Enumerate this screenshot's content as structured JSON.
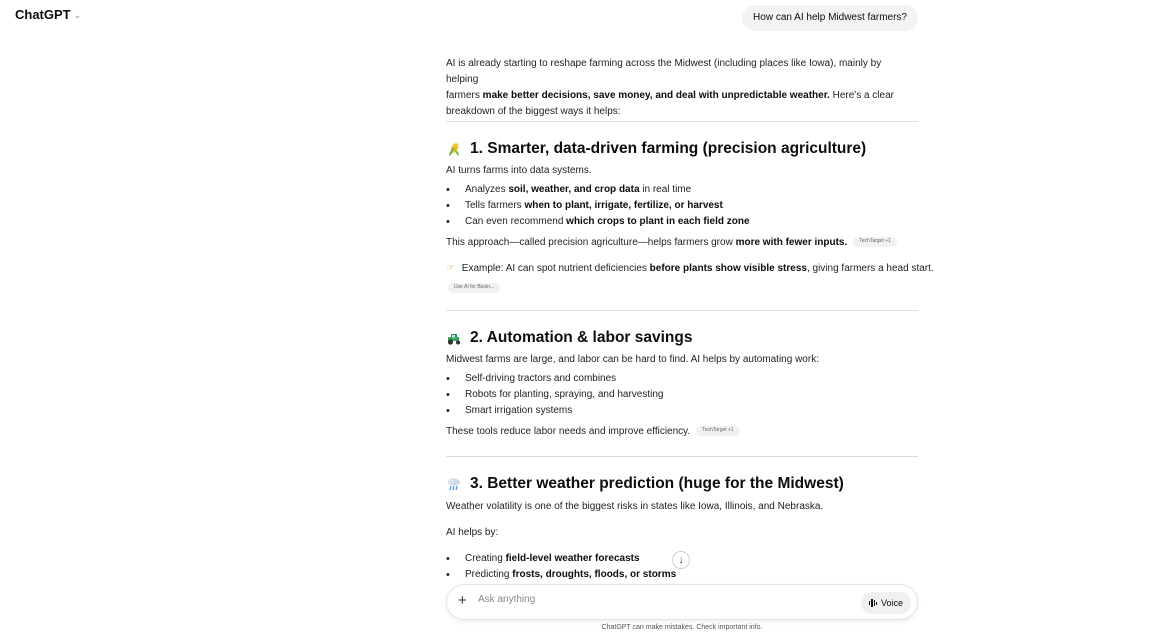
{
  "header": {
    "app_title": "ChatGPT",
    "chevron": "chevron-down-icon"
  },
  "user_message": "How can AI help Midwest farmers?",
  "intro": {
    "l1": "AI is already starting to reshape farming across the Midwest (including places like Iowa), mainly by helping",
    "l2a": "farmers ",
    "l2b": "make better decisions, save money, and deal with unpredictable weather.",
    "l2c": " Here's a clear",
    "l3": "breakdown of the biggest ways it helps:"
  },
  "s1": {
    "icon": "corn-icon",
    "heading": "1. Smarter, data-driven farming (precision agriculture)",
    "sub": "AI turns farms into data systems.",
    "b1a": "Analyzes ",
    "b1b": "soil, weather, and crop data",
    "b1c": " in real time",
    "b2a": "Tells farmers ",
    "b2b": "when to plant, irrigate, fertilize, or harvest",
    "b3a": "Can even recommend ",
    "b3b": "which crops to plant in each field zone",
    "p1a": "This approach—called precision agriculture—helps farmers grow ",
    "p1b": "more with fewer inputs.",
    "cite1": "TechTarget +1",
    "ex_icon": "pointing-hand-icon",
    "ex_a": "Example: AI can spot nutrient deficiencies ",
    "ex_b": "before plants show visible stress",
    "ex_c": ", giving farmers a head start.",
    "cite2": "Use AI for Busin..."
  },
  "s2": {
    "icon": "tractor-icon",
    "heading": "2. Automation & labor savings",
    "sub": "Midwest farms are large, and labor can be hard to find. AI helps by automating work:",
    "b1": "Self-driving tractors and combines",
    "b2": "Robots for planting, spraying, and harvesting",
    "b3": "Smart irrigation systems",
    "p1": "These tools reduce labor needs and improve efficiency.",
    "cite1": "TechTarget +1"
  },
  "s3": {
    "icon": "rain-cloud-icon",
    "heading": "3. Better weather prediction (huge for the Midwest)",
    "sub": "Weather volatility is one of the biggest risks in states like Iowa, Illinois, and Nebraska.",
    "p2": "AI helps by:",
    "b1a": "Creating ",
    "b1b": "field-level weather forecasts",
    "b2a": "Predicting ",
    "b2b": "frosts, droughts, floods, or storms"
  },
  "composer": {
    "placeholder": "Ask anything",
    "voice_label": "Voice"
  },
  "footer": {
    "disclaimer": "ChatGPT can make mistakes. Check important info."
  },
  "colors": {
    "bubble_bg": "#f3f3f3",
    "divider": "#dcdcdc",
    "text": "#0d0d0d"
  }
}
